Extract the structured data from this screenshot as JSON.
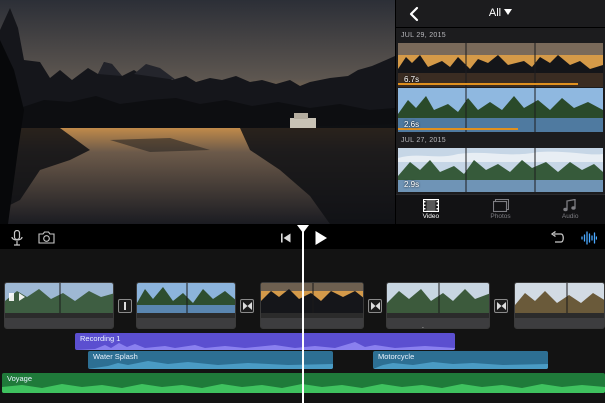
{
  "browser": {
    "filter_label": "All",
    "groups": [
      {
        "date": "JUL 29, 2015",
        "clips": [
          {
            "duration": "6.7s",
            "tone": "sunset"
          },
          {
            "duration": "2.6s",
            "tone": "day"
          }
        ]
      },
      {
        "date": "JUL 27, 2015",
        "clips": [
          {
            "duration": "2.9s",
            "tone": "cloud"
          }
        ]
      }
    ],
    "tabs": [
      {
        "label": "Video",
        "icon": "film-icon",
        "active": true
      },
      {
        "label": "Photos",
        "icon": "photos-icon",
        "active": false
      },
      {
        "label": "Audio",
        "icon": "music-note-icon",
        "active": false
      }
    ]
  },
  "toolbar": {
    "icons": [
      "microphone-icon",
      "camera-icon",
      "skip-back-icon",
      "play-icon",
      "undo-icon",
      "waveform-icon"
    ]
  },
  "timeline": {
    "audio_tracks": [
      {
        "label": "Recording 1",
        "color": "#5b4fd0"
      },
      {
        "label": "Water Splash",
        "color": "#2d6f93"
      },
      {
        "label": "Motorcycle",
        "color": "#2d6f93"
      },
      {
        "label": "Voyage",
        "color": "#1f7a3a"
      }
    ]
  },
  "colors": {
    "accent": "#f0a030",
    "waveform_active": "#4aa8ff",
    "selection_bar": "#e0901e"
  }
}
